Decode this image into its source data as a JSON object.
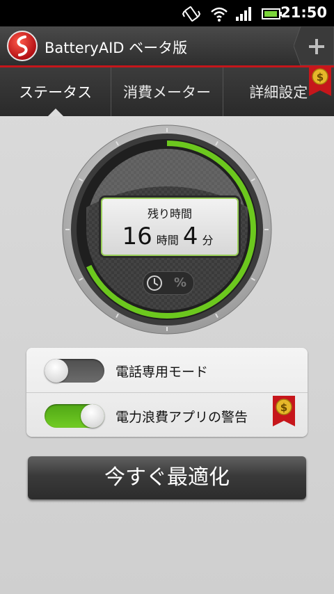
{
  "status_bar": {
    "time": "21:50"
  },
  "app_bar": {
    "title": "BatteryAID ベータ版"
  },
  "tabs": [
    {
      "label": "ステータス",
      "active": true
    },
    {
      "label": "消費メーター",
      "active": false
    },
    {
      "label": "詳細設定",
      "active": false
    }
  ],
  "gauge": {
    "label": "残り時間",
    "hours": "16",
    "hours_unit": "時間",
    "minutes": "4",
    "minutes_unit": "分",
    "percent_symbol": "%",
    "charge_level": 0.68
  },
  "settings": {
    "phone_only_mode": {
      "label": "電話専用モード",
      "on": false
    },
    "power_waste_warning": {
      "label": "電力浪費アプリの警告",
      "on": true
    }
  },
  "optimize_button": {
    "label": "今すぐ最適化"
  },
  "colors": {
    "accent_green": "#6cc81e",
    "brand_red": "#c6161b",
    "premium_gold": "#e6b82a"
  }
}
